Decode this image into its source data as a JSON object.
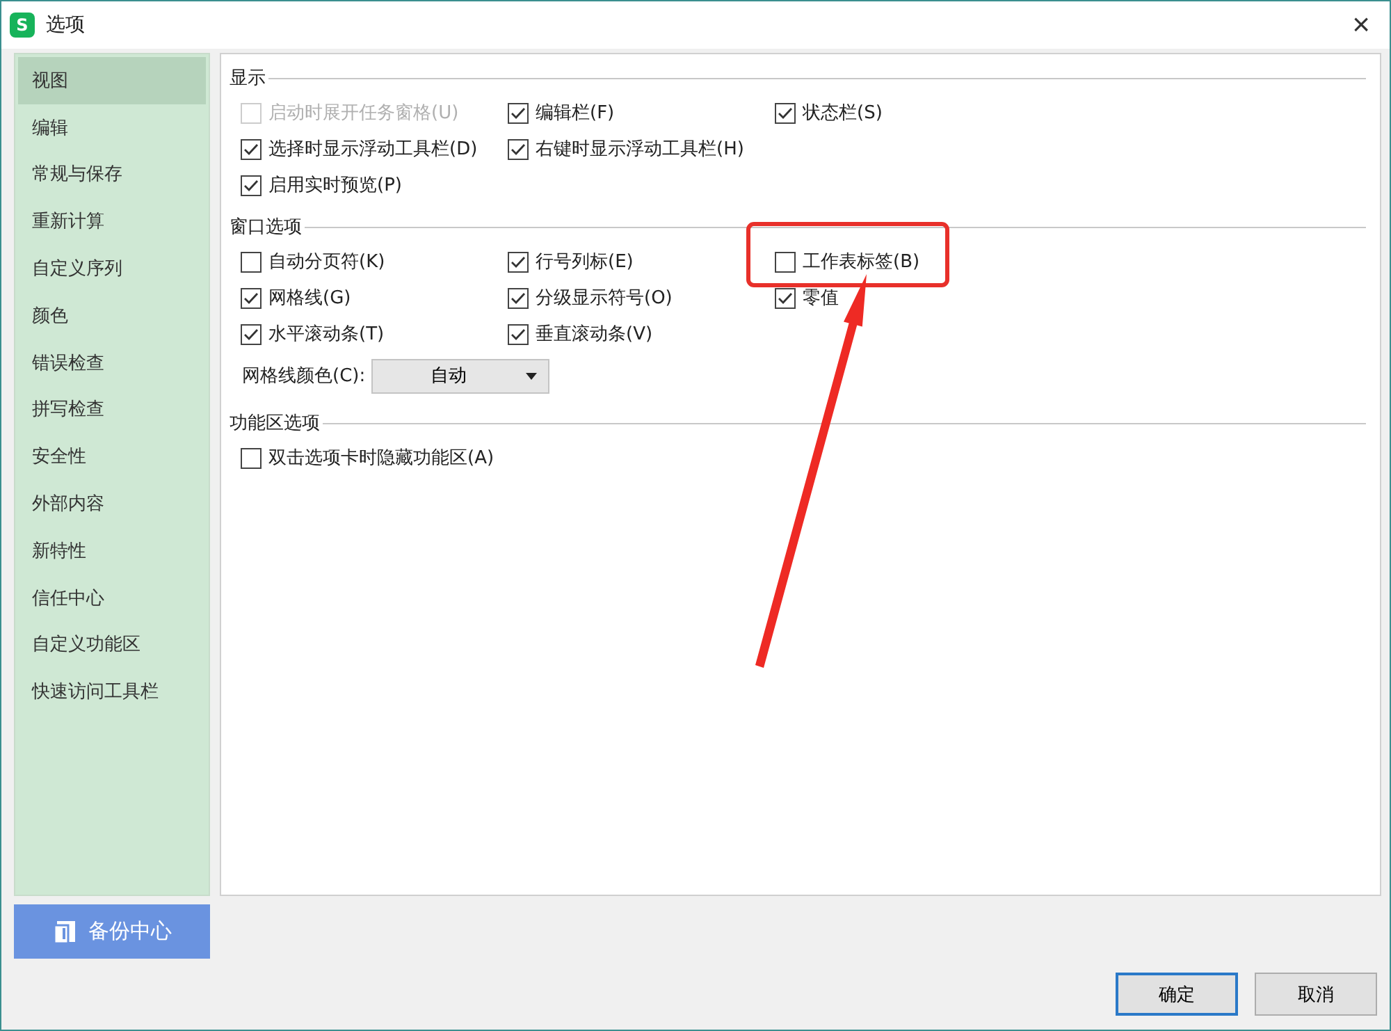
{
  "window": {
    "logo": "S",
    "title": "选项",
    "close": "×"
  },
  "sidebar": {
    "items": [
      {
        "label": "视图",
        "selected": true
      },
      {
        "label": "编辑",
        "selected": false
      },
      {
        "label": "常规与保存",
        "selected": false
      },
      {
        "label": "重新计算",
        "selected": false
      },
      {
        "label": "自定义序列",
        "selected": false
      },
      {
        "label": "颜色",
        "selected": false
      },
      {
        "label": "错误检查",
        "selected": false
      },
      {
        "label": "拼写检查",
        "selected": false
      },
      {
        "label": "安全性",
        "selected": false
      },
      {
        "label": "外部内容",
        "selected": false
      },
      {
        "label": "新特性",
        "selected": false
      },
      {
        "label": "信任中心",
        "selected": false
      },
      {
        "label": "自定义功能区",
        "selected": false
      },
      {
        "label": "快速访问工具栏",
        "selected": false
      }
    ],
    "backup_button": "备份中心"
  },
  "sections": [
    {
      "title": "显示",
      "rows": [
        [
          {
            "label": "启动时展开任务窗格(U)",
            "checked": false,
            "disabled": true
          },
          {
            "label": "编辑栏(F)",
            "checked": true,
            "disabled": false
          },
          {
            "label": "状态栏(S)",
            "checked": true,
            "disabled": false
          }
        ],
        [
          {
            "label": "选择时显示浮动工具栏(D)",
            "checked": true,
            "disabled": false
          },
          {
            "label": "右键时显示浮动工具栏(H)",
            "checked": true,
            "disabled": false
          }
        ],
        [
          {
            "label": "启用实时预览(P)",
            "checked": true,
            "disabled": false
          }
        ]
      ]
    },
    {
      "title": "窗口选项",
      "rows": [
        [
          {
            "label": "自动分页符(K)",
            "checked": false,
            "disabled": false
          },
          {
            "label": "行号列标(E)",
            "checked": true,
            "disabled": false
          },
          {
            "label": "工作表标签(B)",
            "checked": false,
            "disabled": false
          }
        ],
        [
          {
            "label": "网格线(G)",
            "checked": true,
            "disabled": false
          },
          {
            "label": "分级显示符号(O)",
            "checked": true,
            "disabled": false
          },
          {
            "label": "零值",
            "checked": true,
            "disabled": false
          }
        ],
        [
          {
            "label": "水平滚动条(T)",
            "checked": true,
            "disabled": false
          },
          {
            "label": "垂直滚动条(V)",
            "checked": true,
            "disabled": false
          }
        ]
      ],
      "gridline_color": {
        "label": "网格线颜色(C):",
        "value": "自动"
      }
    },
    {
      "title": "功能区选项",
      "rows": [
        [
          {
            "label": "双击选项卡时隐藏功能区(A)",
            "checked": false,
            "disabled": false
          }
        ]
      ]
    }
  ],
  "buttons": [
    {
      "label": "确定",
      "kind": "primary"
    },
    {
      "label": "取消",
      "kind": "secondary"
    }
  ]
}
